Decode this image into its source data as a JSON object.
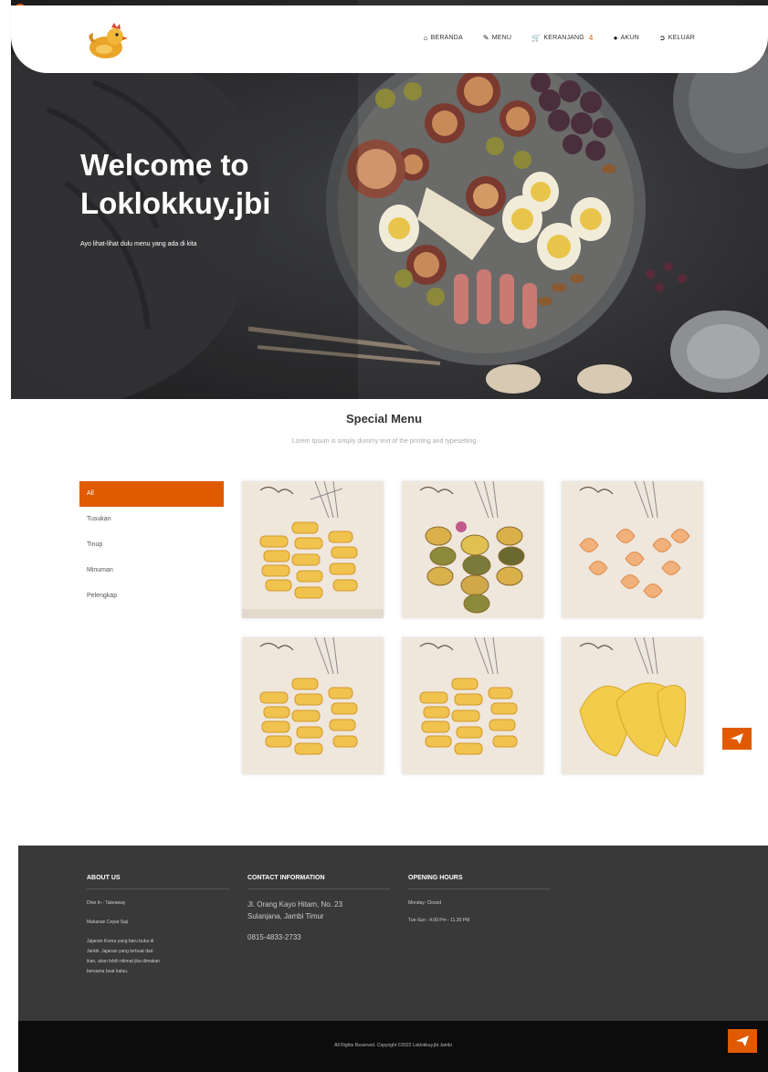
{
  "brand": {
    "logo_icon": "chicken-logo-icon",
    "accent": "#e05a00"
  },
  "nav": {
    "items": [
      {
        "icon": "home-icon",
        "label": "BERANDA"
      },
      {
        "icon": "pencil-icon",
        "label": "MENU"
      },
      {
        "icon": "cart-icon",
        "label": "KERANJANG",
        "badge": "4"
      },
      {
        "icon": "user-icon",
        "label": "AKUN"
      },
      {
        "icon": "logout-icon",
        "label": "KELUAR"
      }
    ]
  },
  "hero": {
    "title_line1": "Welcome to",
    "title_line2": "Loklokkuy.jbi",
    "subtitle": "Ayo lihat-lihat dulu menu yang ada di kita"
  },
  "special": {
    "title": "Special Menu",
    "subtitle": "Lorem Ipsum is simply dummy text of the printing and typesetting",
    "categories": [
      "All",
      "Tusukan",
      "Tinup",
      "Minuman",
      "Pelengkap"
    ],
    "active_category": "All"
  },
  "footer": {
    "about": {
      "heading": "ABOUT US",
      "lines": [
        "Dine In - Takeaway",
        "Makanan Cepat Saji",
        "Jajanan Korea yang baru buka di",
        "Jambi. Jajanan yang terbuat dari",
        "ikan, akan lebih nikmat jika dimakan",
        "bersama buat kalau."
      ]
    },
    "contact": {
      "heading": "CONTACT INFORMATION",
      "address_line1": "Jl. Orang Kayo Hitam, No. 23",
      "address_line2": "Sulanjana, Jambi Timur",
      "phone": "0815-4833-2733"
    },
    "hours": {
      "heading": "OPENING HOURS",
      "line1": "Monday: Closed",
      "line2": "Tue-Sun : 4.00 Pm - 11.30 PM"
    },
    "copyright": "All Rights Reserved. Copyright ©2022 Loklokkuy.jbi Jambi"
  }
}
